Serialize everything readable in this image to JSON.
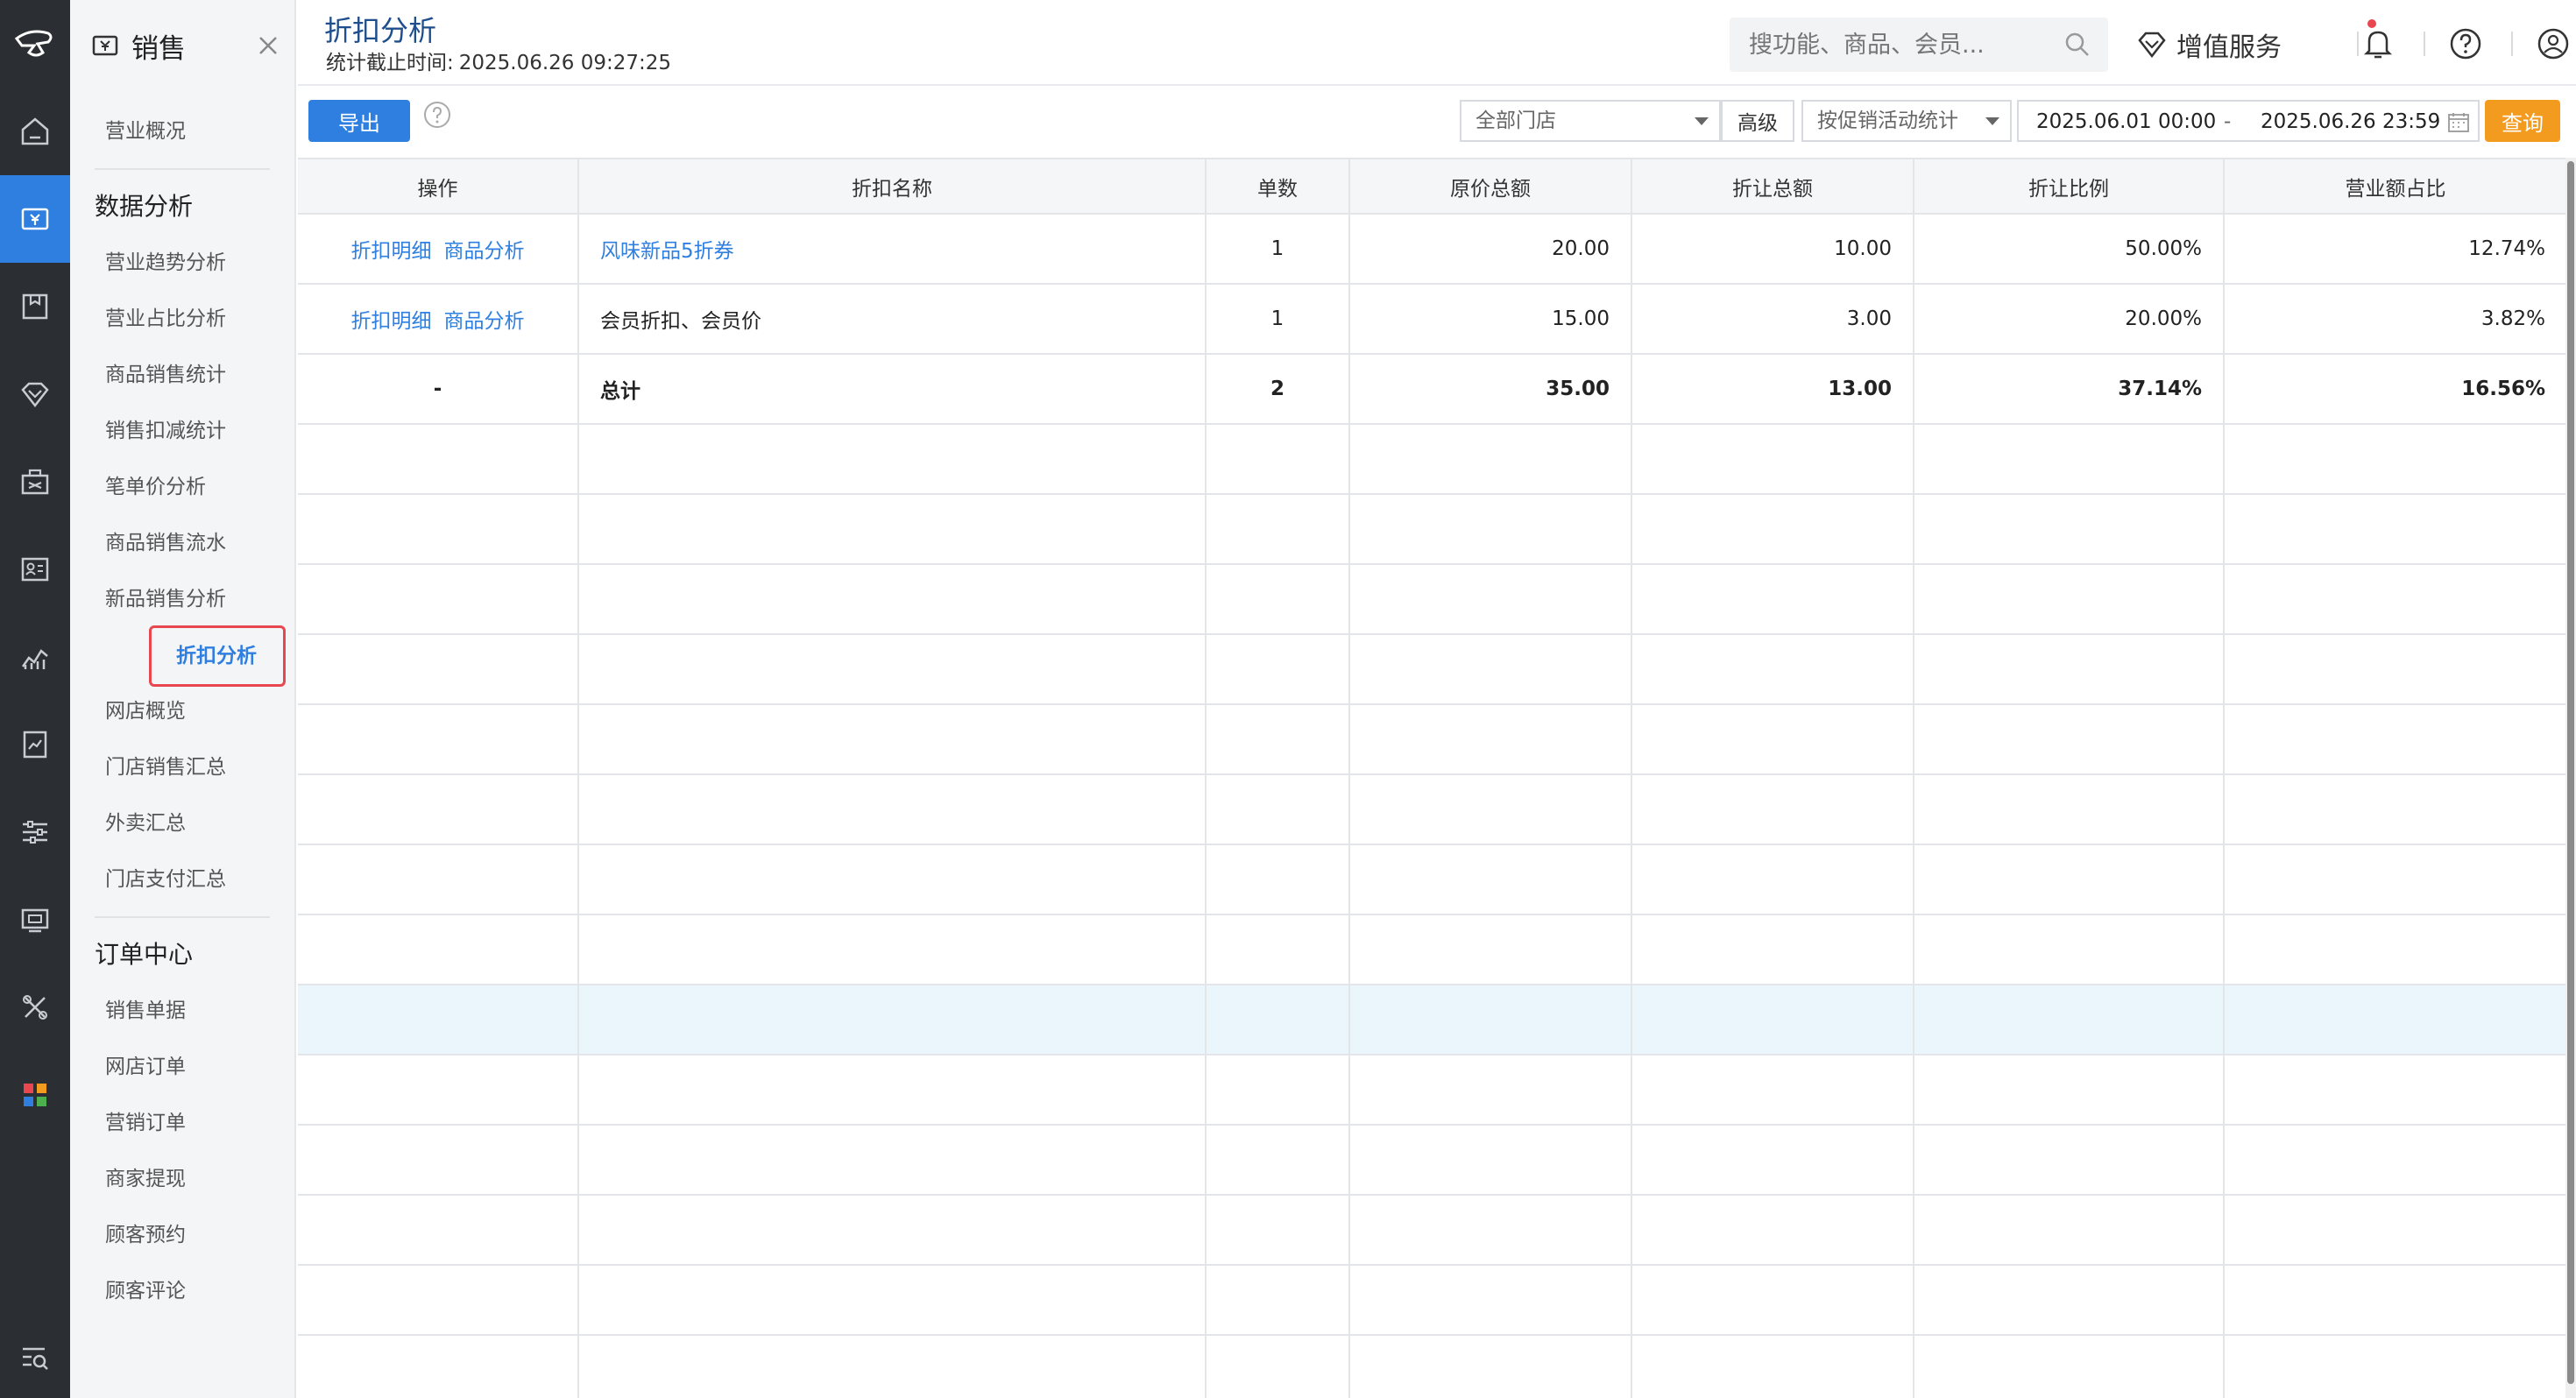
{
  "app": {
    "module": "销售"
  },
  "header": {
    "title": "折扣分析",
    "subtitle_label": "统计截止时间:",
    "subtitle_time": "2025.06.26 09:27:25",
    "search_placeholder": "搜功能、商品、会员...",
    "value_added_service": "增值服务"
  },
  "submenu": {
    "overview": "营业概况",
    "group_data": "数据分析",
    "data_items": [
      "营业趋势分析",
      "营业占比分析",
      "商品销售统计",
      "销售扣减统计",
      "笔单价分析",
      "商品销售流水",
      "新品销售分析",
      "折扣分析",
      "网店概览",
      "门店销售汇总",
      "外卖汇总",
      "门店支付汇总"
    ],
    "group_orders": "订单中心",
    "order_items": [
      "销售单据",
      "网店订单",
      "营销订单",
      "商家提现",
      "顾客预约",
      "顾客评论"
    ]
  },
  "toolbar": {
    "export": "导出",
    "store_select": "全部门店",
    "advanced": "高级",
    "stat_mode": "按促销活动统计",
    "date_start": "2025.06.01 00:00",
    "date_sep": "-",
    "date_end": "2025.06.26 23:59",
    "query": "查询"
  },
  "table": {
    "columns": [
      "操作",
      "折扣名称",
      "单数",
      "原价总额",
      "折让总额",
      "折让比例",
      "营业额占比"
    ],
    "rows": [
      {
        "actions": [
          "折扣明细",
          "商品分析"
        ],
        "name": "风味新品5折券",
        "name_is_link": true,
        "count": "1",
        "orig_total": "20.00",
        "discount_total": "10.00",
        "discount_ratio": "50.00%",
        "revenue_share": "12.74%"
      },
      {
        "actions": [
          "折扣明细",
          "商品分析"
        ],
        "name": "会员折扣、会员价",
        "name_is_link": false,
        "count": "1",
        "orig_total": "15.00",
        "discount_total": "3.00",
        "discount_ratio": "20.00%",
        "revenue_share": "3.82%"
      }
    ],
    "total": {
      "actions": "-",
      "name": "总计",
      "count": "2",
      "orig_total": "35.00",
      "discount_total": "13.00",
      "discount_ratio": "37.14%",
      "revenue_share": "16.56%"
    }
  },
  "colors": {
    "accent": "#2f7fe0",
    "rail": "#2b2f33",
    "query_button": "#f39b1f",
    "active_outline": "#e8474f",
    "row_highlight": "#eaf5fc"
  },
  "icons": {
    "rail": [
      "logo-icon",
      "home-icon",
      "sales-icon",
      "goods-icon",
      "member-icon",
      "marketing-icon",
      "staff-icon",
      "report-icon",
      "finance-icon",
      "settings-icon",
      "device-icon",
      "tools-icon",
      "apps-icon",
      "search-menu-icon"
    ]
  }
}
